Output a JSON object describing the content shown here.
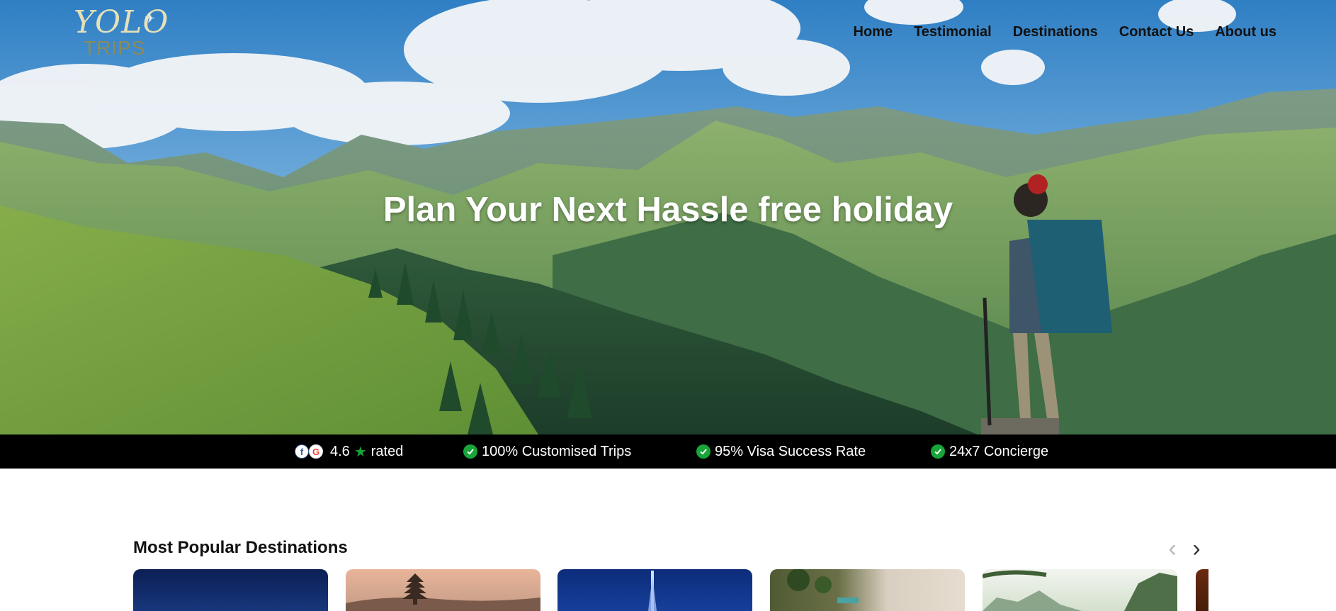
{
  "brand": {
    "logo_script": "YOLO",
    "logo_sub": "TRIPS"
  },
  "nav": {
    "items": [
      "Home",
      "Testimonial",
      "Destinations",
      "Contact Us",
      "About us"
    ]
  },
  "hero": {
    "title": "Plan Your Next Hassle free holiday"
  },
  "trust": {
    "rating": "4.6",
    "rated_label": "rated",
    "items": [
      "100% Customised Trips",
      "95% Visa Success Rate",
      "24x7 Concierge"
    ]
  },
  "destinations": {
    "title": "Most Popular Destinations",
    "prev_icon": "chevron-left-icon",
    "next_icon": "chevron-right-icon"
  },
  "colors": {
    "trust_bar_bg": "#000000",
    "check_green": "#18a53a",
    "nav_text": "#111111"
  }
}
